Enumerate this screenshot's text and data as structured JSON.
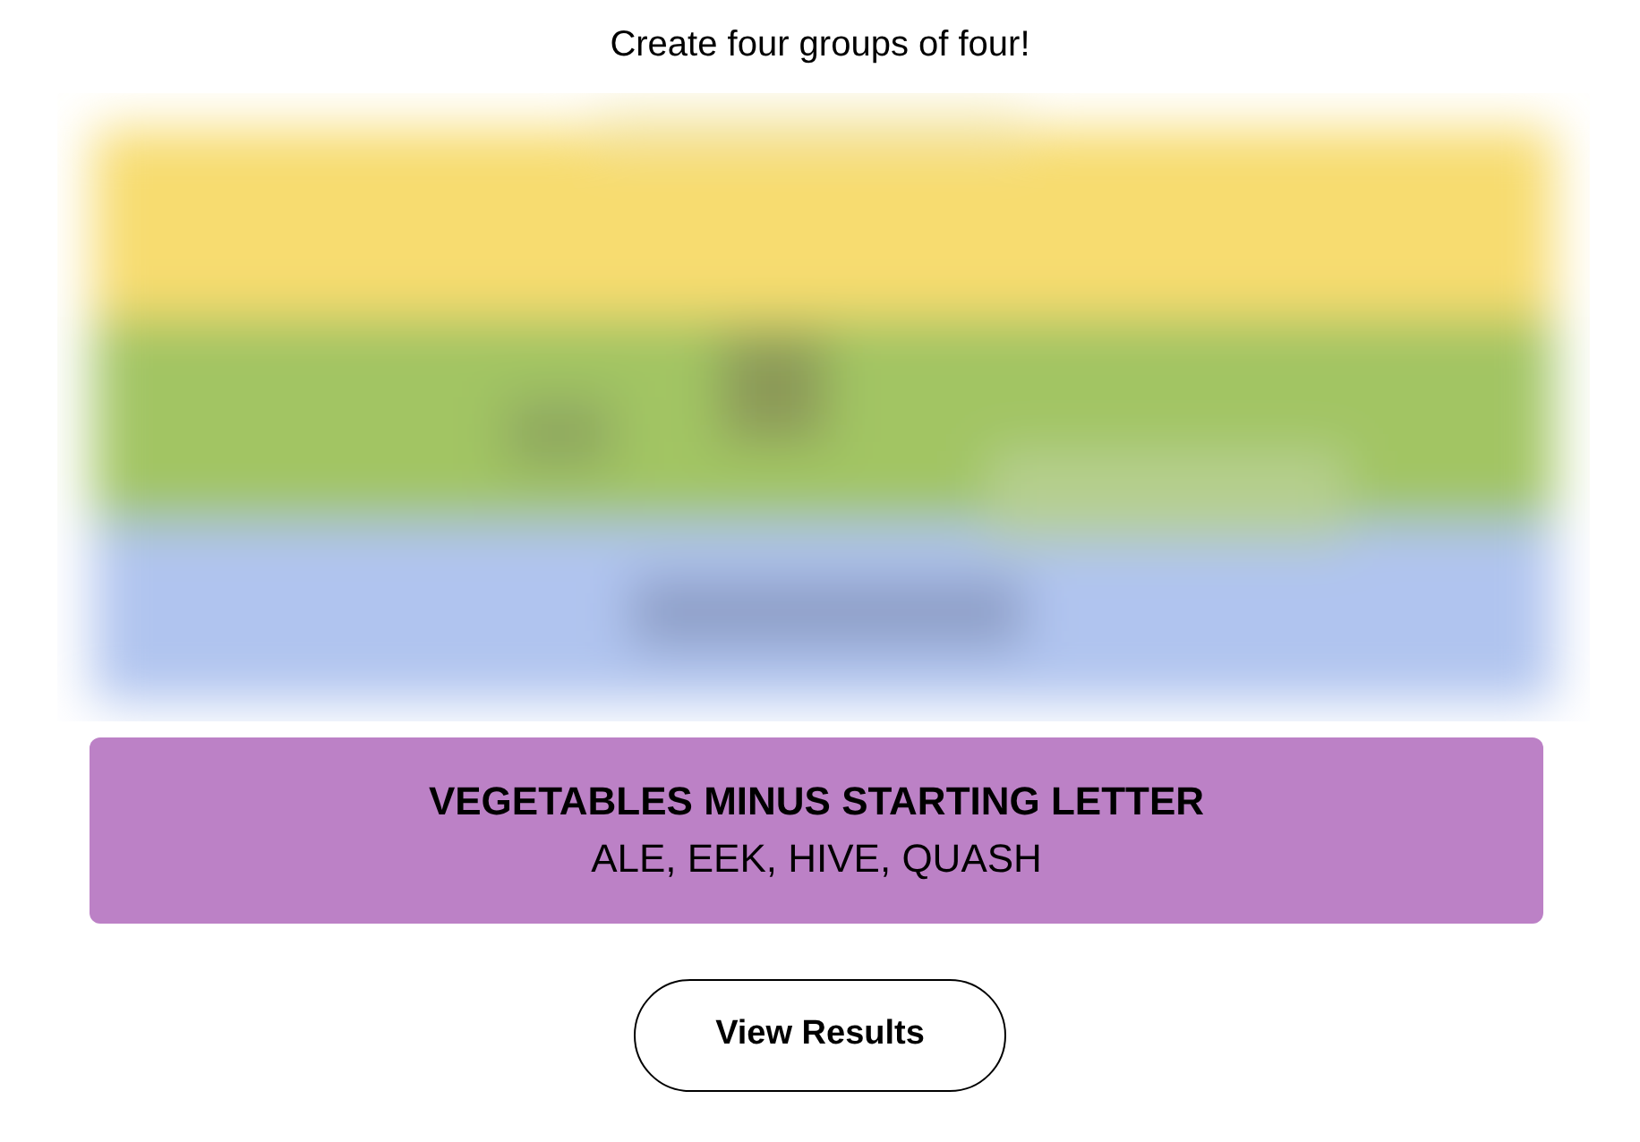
{
  "heading": "Create four groups of four!",
  "solved_group": {
    "title": "VEGETABLES MINUS STARTING LETTER",
    "members": "ALE, EEK, HIVE, QUASH"
  },
  "button": {
    "label": "View Results"
  }
}
